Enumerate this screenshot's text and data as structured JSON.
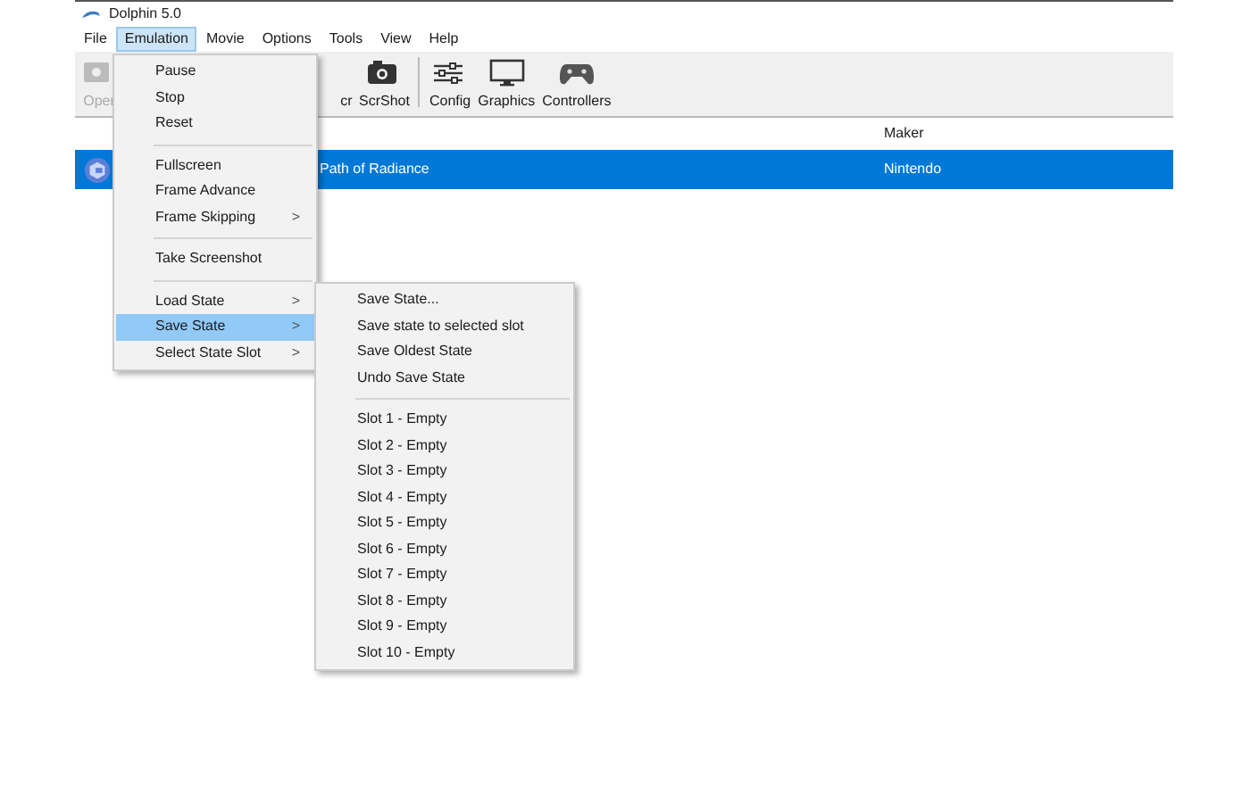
{
  "window": {
    "title": "Dolphin 5.0"
  },
  "menu_bar": [
    {
      "label": "File",
      "selected": false
    },
    {
      "label": "Emulation",
      "selected": true
    },
    {
      "label": "Movie",
      "selected": false
    },
    {
      "label": "Options",
      "selected": false
    },
    {
      "label": "Tools",
      "selected": false
    },
    {
      "label": "View",
      "selected": false
    },
    {
      "label": "Help",
      "selected": false
    }
  ],
  "toolbar": [
    {
      "label": "Oper",
      "kind": "open",
      "disabled": true
    },
    {
      "label": "cr",
      "kind": "partial",
      "disabled": false
    },
    {
      "label": "ScrShot",
      "kind": "camera",
      "disabled": false
    },
    {
      "kind": "separator"
    },
    {
      "label": "Config",
      "kind": "sliders",
      "disabled": false
    },
    {
      "label": "Graphics",
      "kind": "monitor",
      "disabled": false
    },
    {
      "label": "Controllers",
      "kind": "gamepad",
      "disabled": false
    }
  ],
  "game_list": {
    "columns": [
      {
        "label": "Maker"
      }
    ],
    "rows": [
      {
        "title": "Path of Radiance",
        "maker": "Nintendo",
        "selected": true
      }
    ]
  },
  "emulation_menu": [
    {
      "label": "Pause",
      "submenu": false,
      "selected": false
    },
    {
      "label": "Stop",
      "submenu": false,
      "selected": false
    },
    {
      "label": "Reset",
      "submenu": false,
      "selected": false
    },
    {
      "kind": "separator"
    },
    {
      "label": "Fullscreen",
      "submenu": false,
      "selected": false
    },
    {
      "label": "Frame Advance",
      "submenu": false,
      "selected": false
    },
    {
      "label": "Frame Skipping",
      "submenu": true,
      "selected": false
    },
    {
      "kind": "separator"
    },
    {
      "label": "Take Screenshot",
      "submenu": false,
      "selected": false
    },
    {
      "kind": "separator"
    },
    {
      "label": "Load State",
      "submenu": true,
      "selected": false
    },
    {
      "label": "Save State",
      "submenu": true,
      "selected": true
    },
    {
      "label": "Select State Slot",
      "submenu": true,
      "selected": false
    }
  ],
  "save_state_menu": [
    {
      "label": "Save State..."
    },
    {
      "label": "Save state to selected slot"
    },
    {
      "label": "Save Oldest State"
    },
    {
      "label": "Undo Save State"
    },
    {
      "kind": "separator"
    },
    {
      "label": "Slot 1 - Empty"
    },
    {
      "label": "Slot 2 - Empty"
    },
    {
      "label": "Slot 3 - Empty"
    },
    {
      "label": "Slot 4 - Empty"
    },
    {
      "label": "Slot 5 - Empty"
    },
    {
      "label": "Slot 6 - Empty"
    },
    {
      "label": "Slot 7 - Empty"
    },
    {
      "label": "Slot 8 - Empty"
    },
    {
      "label": "Slot 9 - Empty"
    },
    {
      "label": "Slot 10 - Empty"
    }
  ],
  "submenu_arrow": ">"
}
